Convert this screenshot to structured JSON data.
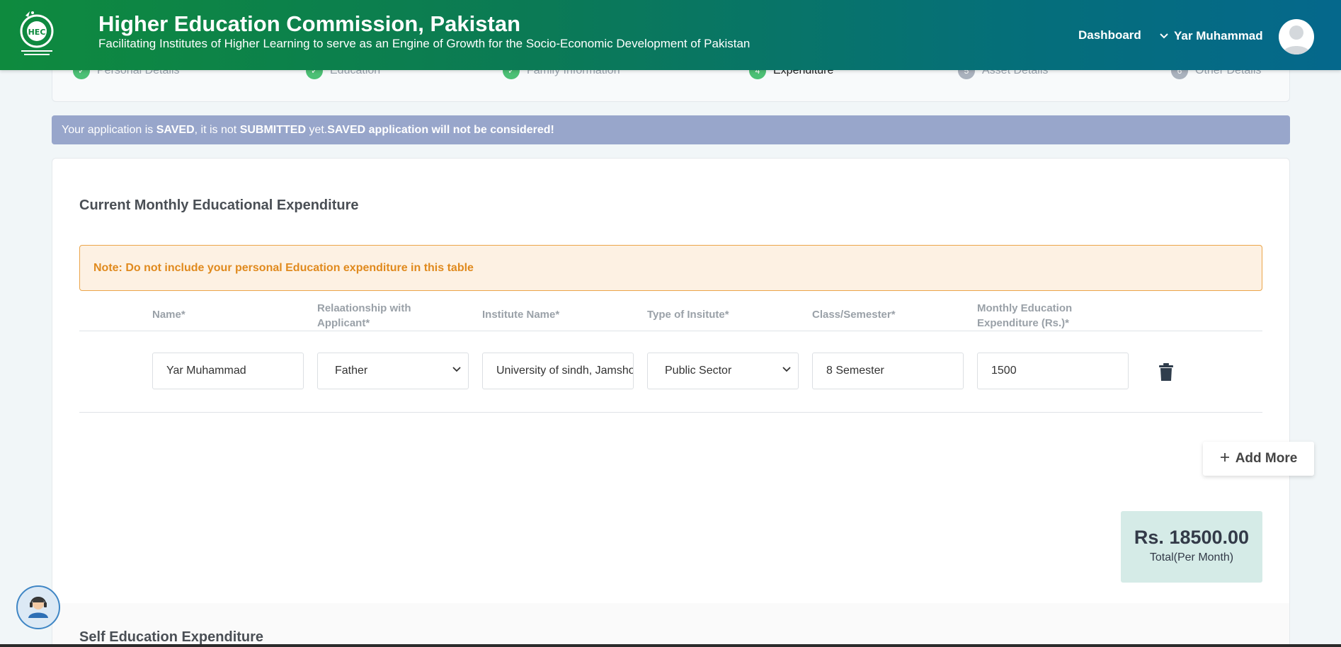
{
  "header": {
    "title": "Higher Education Commission, Pakistan",
    "subtitle": "Facilitating Institutes of Higher Learning to serve as an Engine of Growth for the Socio-Economic Development of Pakistan",
    "dashboard_label": "Dashboard",
    "user_name": "Yar Muhammad",
    "logo_icon": "hec-logo-icon",
    "avatar_icon": "user-avatar-icon"
  },
  "stepper": {
    "steps": [
      {
        "num": "✓",
        "label": "Personal Details",
        "state": "done"
      },
      {
        "num": "✓",
        "label": "Education",
        "state": "done"
      },
      {
        "num": "✓",
        "label": "Family Information",
        "state": "done"
      },
      {
        "num": "4",
        "label": "Expenditure",
        "state": "active"
      },
      {
        "num": "5",
        "label": "Asset Details",
        "state": "pending"
      },
      {
        "num": "6",
        "label": "Other Details",
        "state": "pending"
      }
    ]
  },
  "alert": {
    "p1": "Your application is ",
    "b1": "SAVED",
    "p2": ", it is not ",
    "b2": "SUBMITTED",
    "p3": " yet.",
    "b3": "SAVED application will not be considered!"
  },
  "expenditure": {
    "title": "Current Monthly Educational Expenditure",
    "note": "Note: Do not include your personal Education expenditure in this table",
    "columns": {
      "name": "Name*",
      "relationship_1": "Relaationship with",
      "relationship_2": "Applicant*",
      "institute": "Institute Name*",
      "type": "Type of Insitute*",
      "class": "Class/Semester*",
      "monthly_1": "Monthly Education",
      "monthly_2": "Expenditure (Rs.)*"
    },
    "rows": [
      {
        "name": "Yar Muhammad",
        "relationship": "Father",
        "institute": "University of sindh, Jamshoro",
        "type": "Public Sector",
        "class": "8 Semester",
        "amount": "1500"
      }
    ],
    "add_more_label": "Add More",
    "total_amount": "Rs. 18500.00",
    "total_label": "Total(Per Month)"
  },
  "self_expenditure": {
    "title": "Self Education Expenditure"
  },
  "colors": {
    "header_gradient_start": "#0e8a3e",
    "header_gradient_end": "#05688c",
    "alert_bg": "#98a6cb",
    "note_text": "#e08a1e",
    "total_bg": "#d5ebe7",
    "step_done": "#4cc075"
  }
}
